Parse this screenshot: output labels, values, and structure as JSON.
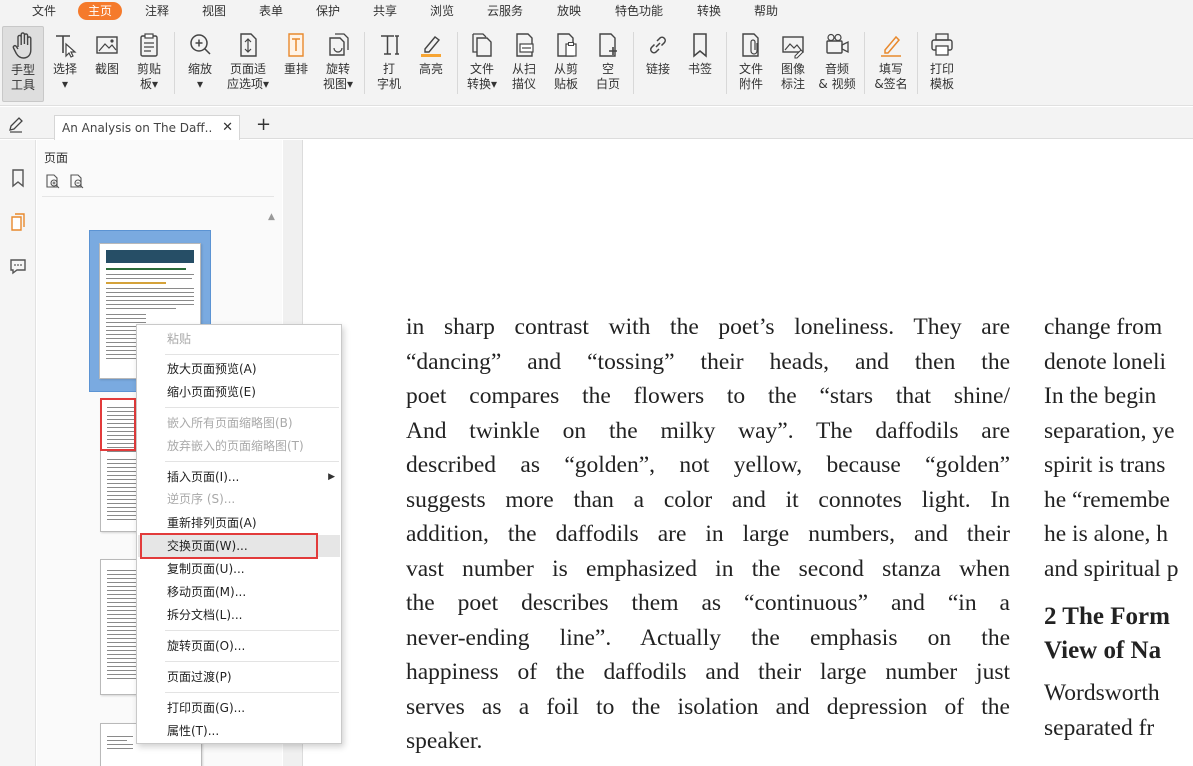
{
  "menu": {
    "items": [
      "文件",
      "主页",
      "注释",
      "视图",
      "表单",
      "保护",
      "共享",
      "浏览",
      "云服务",
      "放映",
      "特色功能",
      "转换",
      "帮助"
    ],
    "active": "主页",
    "accent": "#f57a2b"
  },
  "ribbon": {
    "tools": [
      {
        "label": "手型\n工具",
        "icon": "hand-icon"
      },
      {
        "label": "选择\n▾",
        "icon": "select-cursor-icon"
      },
      {
        "label": "截图",
        "icon": "screenshot-icon"
      },
      {
        "label": "剪贴\n板▾",
        "icon": "clipboard-icon"
      },
      {
        "label": "缩放\n▾",
        "icon": "zoom-icon"
      },
      {
        "label": "页面适\n应选项▾",
        "icon": "fit-page-icon"
      },
      {
        "label": "重排",
        "icon": "reflow-icon"
      },
      {
        "label": "旋转\n视图▾",
        "icon": "rotate-view-icon"
      },
      {
        "label": "打\n字机",
        "icon": "typewriter-icon"
      },
      {
        "label": "高亮",
        "icon": "highlight-icon"
      },
      {
        "label": "文件\n转换▾",
        "icon": "file-convert-icon"
      },
      {
        "label": "从扫\n描仪",
        "icon": "scanner-icon"
      },
      {
        "label": "从剪\n贴板",
        "icon": "from-clipboard-icon"
      },
      {
        "label": "空\n白页",
        "icon": "blank-page-icon"
      },
      {
        "label": "链接",
        "icon": "link-icon"
      },
      {
        "label": "书签",
        "icon": "bookmark-icon"
      },
      {
        "label": "文件\n附件",
        "icon": "attachment-icon"
      },
      {
        "label": "图像\n标注",
        "icon": "image-annotation-icon"
      },
      {
        "label": "音频\n& 视频",
        "icon": "video-icon"
      },
      {
        "label": "填写\n&签名",
        "icon": "sign-icon"
      },
      {
        "label": "打印\n模板",
        "icon": "print-template-icon"
      }
    ]
  },
  "tabs": {
    "doc_title": "An Analysis on The Daff...",
    "close": "✕",
    "new": "+"
  },
  "panel": {
    "title": "页面"
  },
  "document": {
    "col1": [
      "in sharp contrast with the poet’s loneliness. They are",
      "“dancing” and “tossing” their heads, and then the",
      "poet compares the flowers to the “stars that shine/",
      "And twinkle on the milky way”. The daffodils are",
      "described as “golden”, not yellow, because “golden”",
      "suggests more than a color and it connotes light. In",
      "addition, the daffodils are in large numbers, and their",
      "vast number is emphasized in the second stanza when",
      "the poet describes them as “continuous” and “in a",
      "never-ending line”. Actually the emphasis on the",
      "happiness of the daffodils and their large number just",
      "serves as a foil to the isolation and depression of the",
      "speaker."
    ],
    "col2_top": [
      "change from",
      "denote loneli",
      "In the begin",
      "separation, ye",
      "spirit is trans",
      "he “remembe",
      "he is alone, h",
      "and spiritual p"
    ],
    "col2_heading": [
      "2  The Form",
      "View of Na"
    ],
    "col2_bottom": [
      "Wordsworth",
      "separated fr"
    ]
  },
  "context_menu": {
    "items": [
      {
        "label": "粘贴",
        "disabled": true
      },
      {
        "label": "放大页面预览(A)",
        "disabled": false
      },
      {
        "label": "缩小页面预览(E)",
        "disabled": false
      },
      {
        "label": "嵌入所有页面缩略图(B)",
        "disabled": true
      },
      {
        "label": "放弃嵌入的页面缩略图(T)",
        "disabled": true
      },
      {
        "label": "插入页面(I)...",
        "disabled": false,
        "submenu": true
      },
      {
        "label": "逆页序 (S)...",
        "disabled": true
      },
      {
        "label": "重新排列页面(A)",
        "disabled": false
      },
      {
        "label": "交换页面(W)...",
        "disabled": false,
        "highlighted": true
      },
      {
        "label": "复制页面(U)...",
        "disabled": false
      },
      {
        "label": "移动页面(M)...",
        "disabled": false
      },
      {
        "label": "拆分文档(L)...",
        "disabled": false
      },
      {
        "label": "旋转页面(O)...",
        "disabled": false
      },
      {
        "label": "页面过渡(P)",
        "disabled": false
      },
      {
        "label": "打印页面(G)...",
        "disabled": false
      },
      {
        "label": "属性(T)...",
        "disabled": false
      }
    ]
  }
}
